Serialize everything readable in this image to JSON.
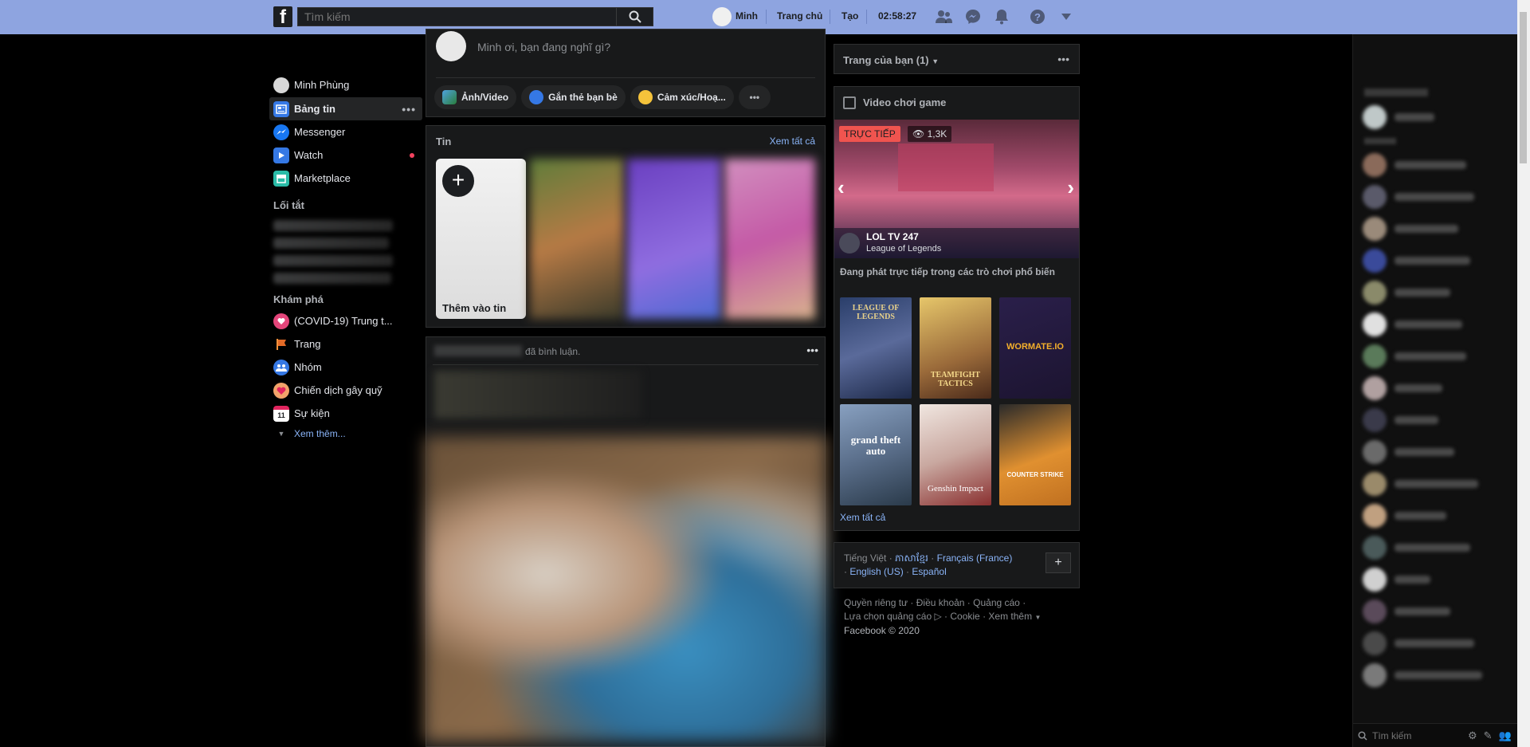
{
  "topbar": {
    "logo": "f",
    "search_placeholder": "Tìm kiếm",
    "profile_name": "Minh",
    "home_label": "Trang chủ",
    "create_label": "Tạo",
    "clock": "02:58:27"
  },
  "leftnav": {
    "profile": "Minh Phùng",
    "items": [
      {
        "label": "Bảng tin",
        "icon": "news-feed-icon"
      },
      {
        "label": "Messenger",
        "icon": "messenger-icon"
      },
      {
        "label": "Watch",
        "icon": "watch-icon"
      },
      {
        "label": "Marketplace",
        "icon": "marketplace-icon"
      }
    ],
    "shortcuts_heading": "Lối tắt",
    "explore_heading": "Khám phá",
    "explore": [
      {
        "label": "(COVID-19) Trung t...",
        "icon": "covid-info-icon"
      },
      {
        "label": "Trang",
        "icon": "flag-icon"
      },
      {
        "label": "Nhóm",
        "icon": "groups-icon"
      },
      {
        "label": "Chiến dịch gây quỹ",
        "icon": "fundraiser-icon"
      },
      {
        "label": "Sự kiện",
        "icon": "calendar-icon"
      }
    ],
    "see_more": "Xem thêm..."
  },
  "composer": {
    "placeholder": "Minh ơi, bạn đang nghĩ gì?",
    "actions": [
      "Ảnh/Video",
      "Gắn thẻ bạn bè",
      "Cảm xúc/Hoạ..."
    ]
  },
  "stories": {
    "heading": "Tin",
    "see_all": "Xem tất cả",
    "add_story": "Thêm vào tin"
  },
  "feed": {
    "activity_text": "đã bình luận."
  },
  "right": {
    "your_pages": "Trang của bạn (1)",
    "games_heading": "Video chơi game",
    "live_badge": "TRỰC TIẾP",
    "viewers": "1,3K",
    "stream_name": "LOL TV 247",
    "stream_game": "League of Legends",
    "popular_heading": "Đang phát trực tiếp trong các trò chơi phổ biến",
    "games": [
      {
        "name": "LEAGUE OF LEGENDS",
        "color": "#3b4f7a"
      },
      {
        "name": "TEAMFIGHT TACTICS",
        "color": "#b0884a"
      },
      {
        "name": "WORMATE.IO",
        "color": "#2a1f4a"
      },
      {
        "name": "grand theft auto",
        "color": "#5b6e8a"
      },
      {
        "name": "Genshin Impact",
        "color": "#c9b8b4"
      },
      {
        "name": "COUNTER STRIKE",
        "color": "#d9892d"
      }
    ],
    "see_all": "Xem tất cả"
  },
  "languages": {
    "current": "Tiếng Việt",
    "options": [
      "ភាសាខ្មែរ",
      "Français (France)",
      "English (US)",
      "Español"
    ]
  },
  "footer": {
    "line1": [
      "Quyền riêng tư",
      "Điều khoản",
      "Quảng cáo"
    ],
    "line2": [
      "Lựa chọn quảng cáo",
      "Cookie",
      "Xem thêm"
    ],
    "copyright": "Facebook © 2020"
  },
  "chat": {
    "search_placeholder": "Tìm kiếm"
  }
}
